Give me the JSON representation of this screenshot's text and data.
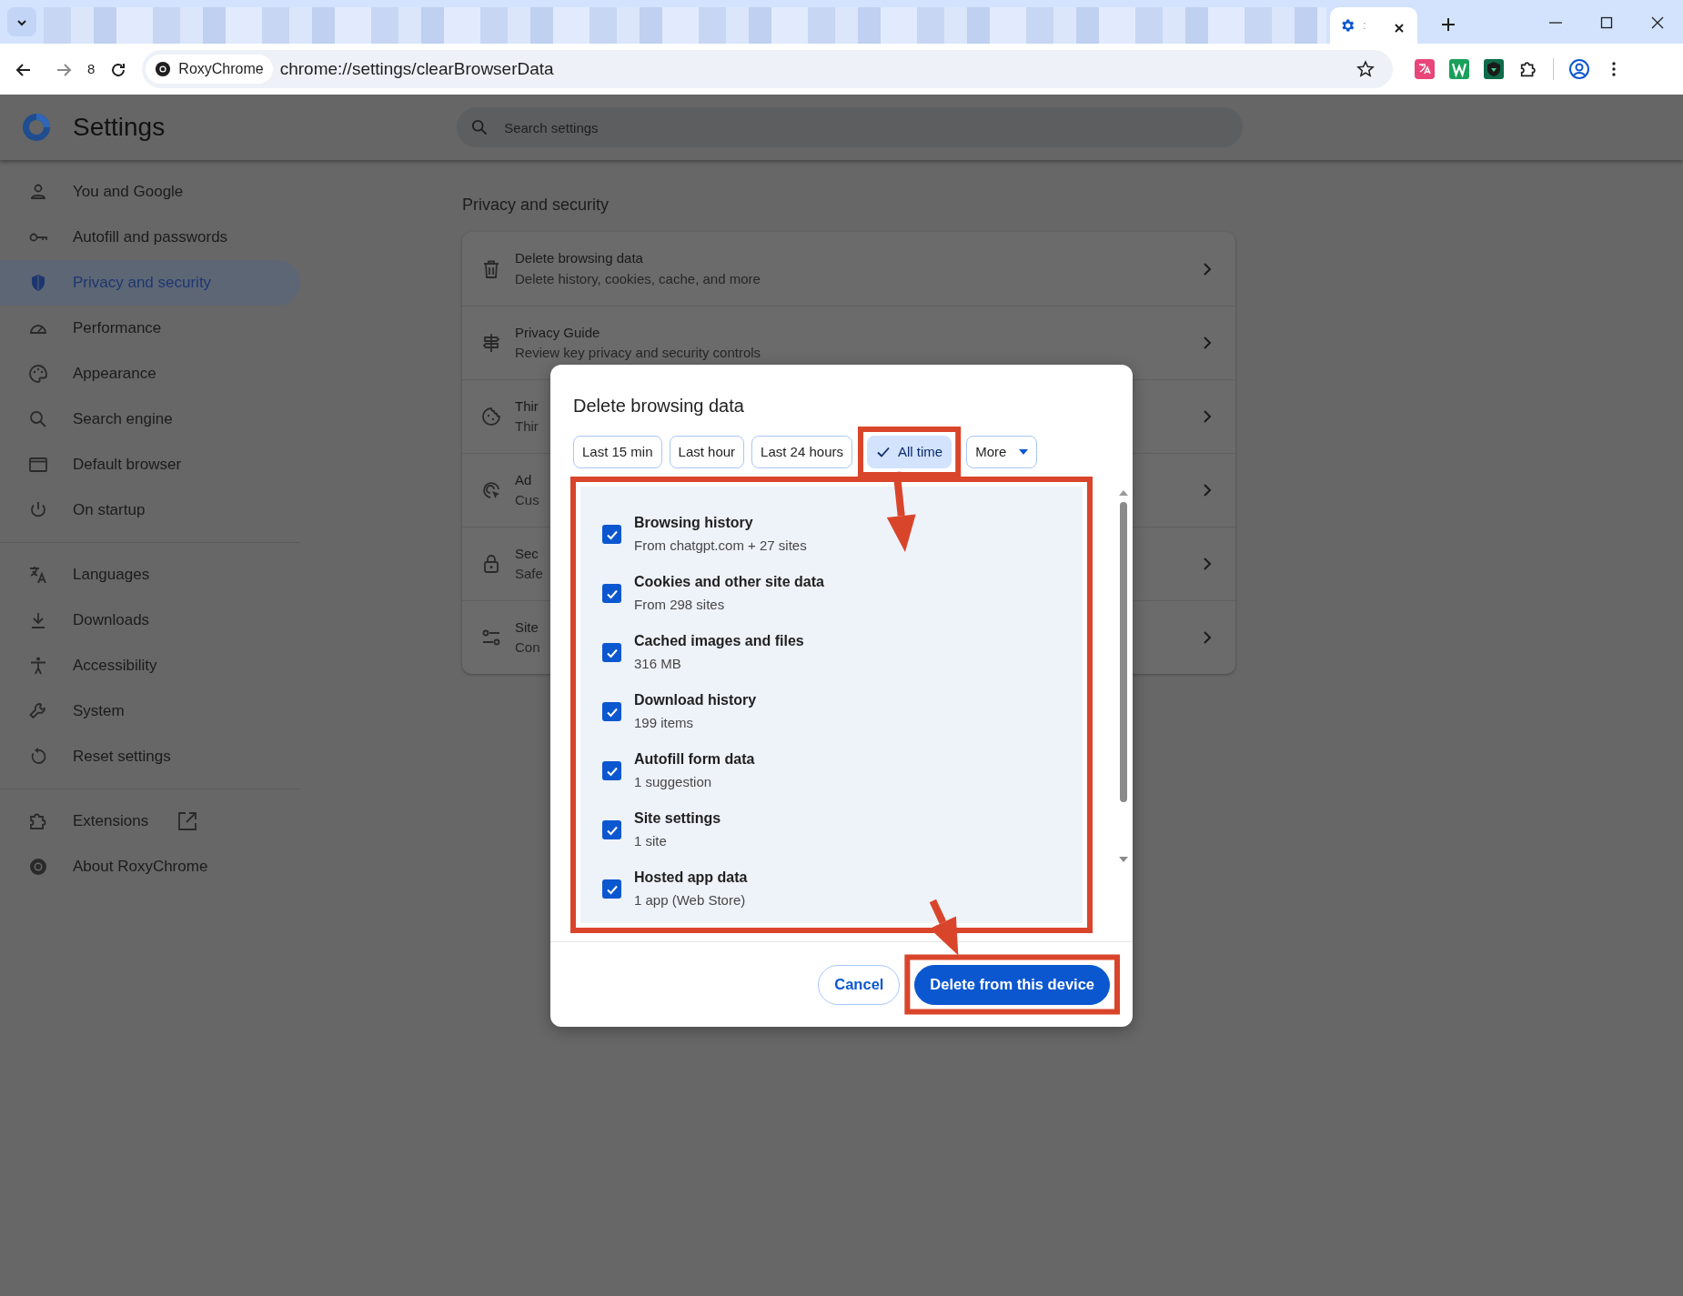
{
  "browser": {
    "active_tab": {
      "title": ":"
    },
    "toolbar": {
      "badge": "8",
      "site_chip": "RoxyChrome",
      "url": "chrome://settings/clearBrowserData"
    }
  },
  "settings": {
    "title": "Settings",
    "search": {
      "placeholder": "Search settings"
    },
    "sidebar": {
      "groups": [
        [
          {
            "label": "You and Google",
            "selected": false,
            "external": false
          },
          {
            "label": "Autofill and passwords",
            "selected": false,
            "external": false
          },
          {
            "label": "Privacy and security",
            "selected": true,
            "external": false
          },
          {
            "label": "Performance",
            "selected": false,
            "external": false
          },
          {
            "label": "Appearance",
            "selected": false,
            "external": false
          },
          {
            "label": "Search engine",
            "selected": false,
            "external": false
          },
          {
            "label": "Default browser",
            "selected": false,
            "external": false
          },
          {
            "label": "On startup",
            "selected": false,
            "external": false
          }
        ],
        [
          {
            "label": "Languages",
            "selected": false,
            "external": false
          },
          {
            "label": "Downloads",
            "selected": false,
            "external": false
          },
          {
            "label": "Accessibility",
            "selected": false,
            "external": false
          },
          {
            "label": "System",
            "selected": false,
            "external": false
          },
          {
            "label": "Reset settings",
            "selected": false,
            "external": false
          }
        ],
        [
          {
            "label": "Extensions",
            "selected": false,
            "external": true
          },
          {
            "label": "About RoxyChrome",
            "selected": false,
            "external": false
          }
        ]
      ]
    },
    "section_title": "Privacy and security",
    "rows": [
      {
        "title": "Delete browsing data",
        "subtitle": "Delete history, cookies, cache, and more"
      },
      {
        "title": "Privacy Guide",
        "subtitle": "Review key privacy and security controls"
      },
      {
        "title": "Thir",
        "subtitle": "Thir"
      },
      {
        "title": "Ad",
        "subtitle": "Cus"
      },
      {
        "title": "Sec",
        "subtitle": "Safe"
      },
      {
        "title": "Site",
        "subtitle": "Con"
      }
    ]
  },
  "dialog": {
    "title": "Delete browsing data",
    "time_ranges": [
      {
        "label": "Last 15 min",
        "selected": false,
        "kind": "chip"
      },
      {
        "label": "Last hour",
        "selected": false,
        "kind": "chip"
      },
      {
        "label": "Last 24 hours",
        "selected": false,
        "kind": "chip"
      },
      {
        "label": "All time",
        "selected": true,
        "kind": "chip"
      },
      {
        "label": "More",
        "selected": false,
        "kind": "dropdown"
      }
    ],
    "items": [
      {
        "title": "Browsing history",
        "detail": "From chatgpt.com + 27 sites",
        "checked": true
      },
      {
        "title": "Cookies and other site data",
        "detail": "From 298 sites",
        "checked": true
      },
      {
        "title": "Cached images and files",
        "detail": "316 MB",
        "checked": true
      },
      {
        "title": "Download history",
        "detail": "199 items",
        "checked": true
      },
      {
        "title": "Autofill form data",
        "detail": "1 suggestion",
        "checked": true
      },
      {
        "title": "Site settings",
        "detail": "1 site",
        "checked": true
      },
      {
        "title": "Hosted app data",
        "detail": "1 app (Web Store)",
        "checked": true
      }
    ],
    "buttons": [
      {
        "label": "Cancel",
        "kind": "secondary"
      },
      {
        "label": "Delete from this device",
        "kind": "primary"
      }
    ]
  }
}
